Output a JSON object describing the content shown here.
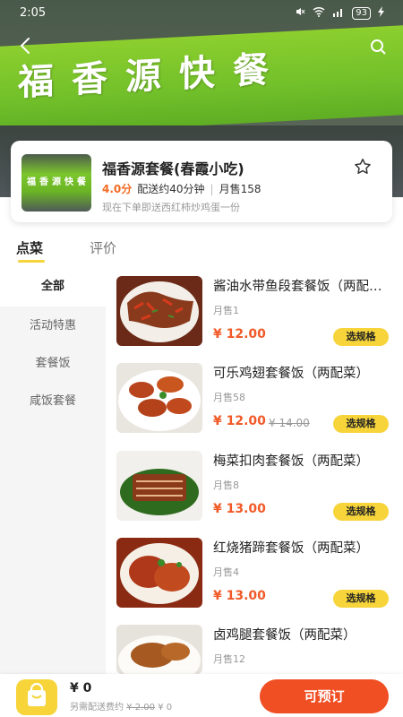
{
  "status_bar": {
    "time": "2:05",
    "battery": "93"
  },
  "banner": {
    "sign_text": "福香源快餐"
  },
  "shop": {
    "thumb_text": "福香源快餐",
    "name": "福香源套餐(春霞小吃)",
    "rating": "4.0分",
    "delivery_time": "配送约40分钟",
    "monthly_sales": "月售158",
    "promo": "现在下单即送西红柿炒鸡蛋一份"
  },
  "tabs": [
    {
      "label": "点菜",
      "active": true
    },
    {
      "label": "评价",
      "active": false
    }
  ],
  "sidebar": {
    "items": [
      {
        "label": "全部",
        "active": true
      },
      {
        "label": "活动特惠",
        "active": false
      },
      {
        "label": "套餐饭",
        "active": false
      },
      {
        "label": "咸饭套餐",
        "active": false
      }
    ]
  },
  "dishes": [
    {
      "name": "酱油水带鱼段套餐饭（两配菜）",
      "sold": "月售1",
      "price": "¥ 12.00",
      "orig_price": "",
      "button": "选规格"
    },
    {
      "name": "可乐鸡翅套餐饭（两配菜）",
      "sold": "月售58",
      "price": "¥ 12.00",
      "orig_price": "¥ 14.00",
      "button": "选规格"
    },
    {
      "name": "梅菜扣肉套餐饭（两配菜）",
      "sold": "月售8",
      "price": "¥ 13.00",
      "orig_price": "",
      "button": "选规格"
    },
    {
      "name": "红烧猪蹄套餐饭（两配菜）",
      "sold": "月售4",
      "price": "¥ 13.00",
      "orig_price": "",
      "button": "选规格"
    },
    {
      "name": "卤鸡腿套餐饭（两配菜）",
      "sold": "月售12",
      "price": "",
      "orig_price": "",
      "button": ""
    }
  ],
  "footer": {
    "total": "¥ 0",
    "fee_prefix": "另需配送费约",
    "fee_original": "¥ 2.00",
    "fee_now": "¥ 0",
    "order_button": "可预订"
  },
  "colors": {
    "accent_yellow": "#f6d43a",
    "accent_orange": "#f04e23",
    "price_color": "#f05a28"
  }
}
